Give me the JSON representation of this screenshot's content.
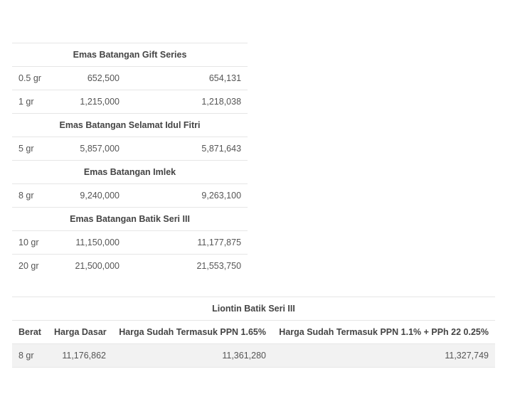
{
  "table1": {
    "sections": [
      {
        "title": "Emas Batangan Gift Series",
        "rows": [
          {
            "weight": "0.5 gr",
            "base": "652,500",
            "final": "654,131"
          },
          {
            "weight": "1 gr",
            "base": "1,215,000",
            "final": "1,218,038"
          }
        ]
      },
      {
        "title": "Emas Batangan Selamat Idul Fitri",
        "rows": [
          {
            "weight": "5 gr",
            "base": "5,857,000",
            "final": "5,871,643"
          }
        ]
      },
      {
        "title": "Emas Batangan Imlek",
        "rows": [
          {
            "weight": "8 gr",
            "base": "9,240,000",
            "final": "9,263,100"
          }
        ]
      },
      {
        "title": "Emas Batangan Batik Seri III",
        "rows": [
          {
            "weight": "10 gr",
            "base": "11,150,000",
            "final": "11,177,875"
          },
          {
            "weight": "20 gr",
            "base": "21,500,000",
            "final": "21,553,750"
          }
        ]
      }
    ]
  },
  "table2": {
    "title": "Liontin Batik Seri III",
    "headers": [
      "Berat",
      "Harga Dasar",
      "Harga Sudah Termasuk PPN 1.65%",
      "Harga Sudah Termasuk PPN 1.1% + PPh 22 0.25%"
    ],
    "rows": [
      {
        "weight": "8 gr",
        "base": "11,176,862",
        "ppn": "11,361,280",
        "ppn_pph": "11,327,749"
      }
    ]
  }
}
